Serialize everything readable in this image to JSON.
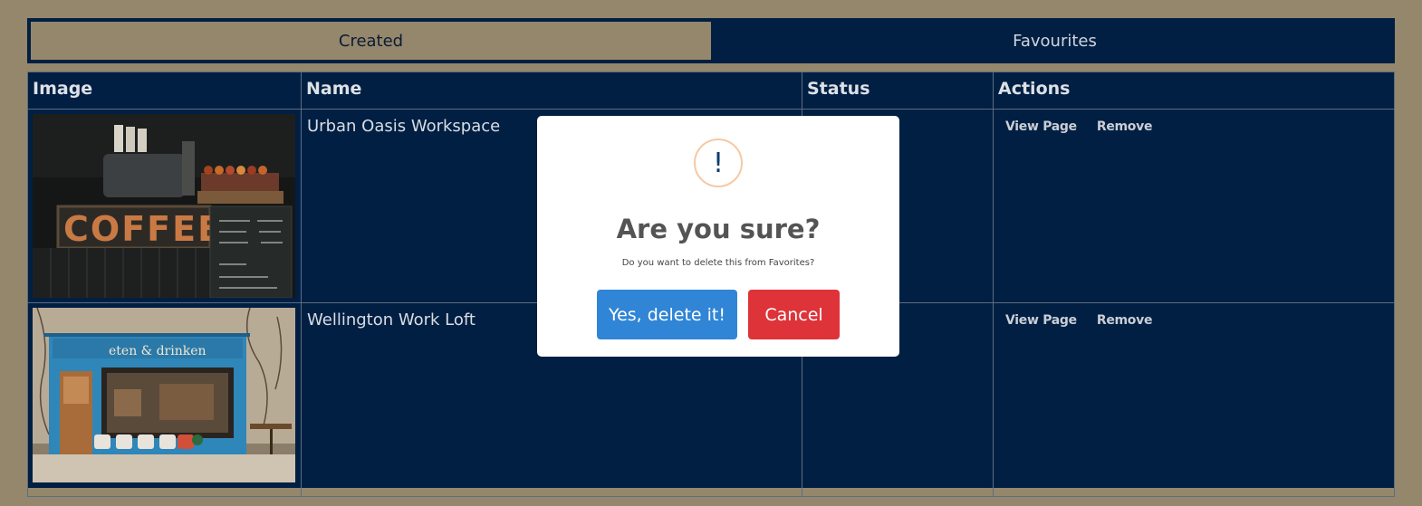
{
  "tabs": [
    {
      "label": "Created",
      "active": true
    },
    {
      "label": "Favourites",
      "active": false
    }
  ],
  "table": {
    "headers": [
      "Image",
      "Name",
      "Status",
      "Actions"
    ],
    "rows": [
      {
        "image": "coffee-shop-photo",
        "name": "Urban Oasis Workspace",
        "status": "",
        "actions": [
          "View Page",
          "Remove"
        ]
      },
      {
        "image": "blue-storefront-photo",
        "name": "Wellington Work Loft",
        "status": "",
        "actions": [
          "View Page",
          "Remove"
        ]
      }
    ]
  },
  "modal": {
    "icon": "!",
    "title": "Are you sure?",
    "text": "Do you want to delete this from Favorites?",
    "confirm_label": "Yes, delete it!",
    "cancel_label": "Cancel"
  },
  "colors": {
    "page_bg": "#94876b",
    "navy": "#001f42",
    "confirm": "#3085d6",
    "cancel": "#dd3339"
  }
}
